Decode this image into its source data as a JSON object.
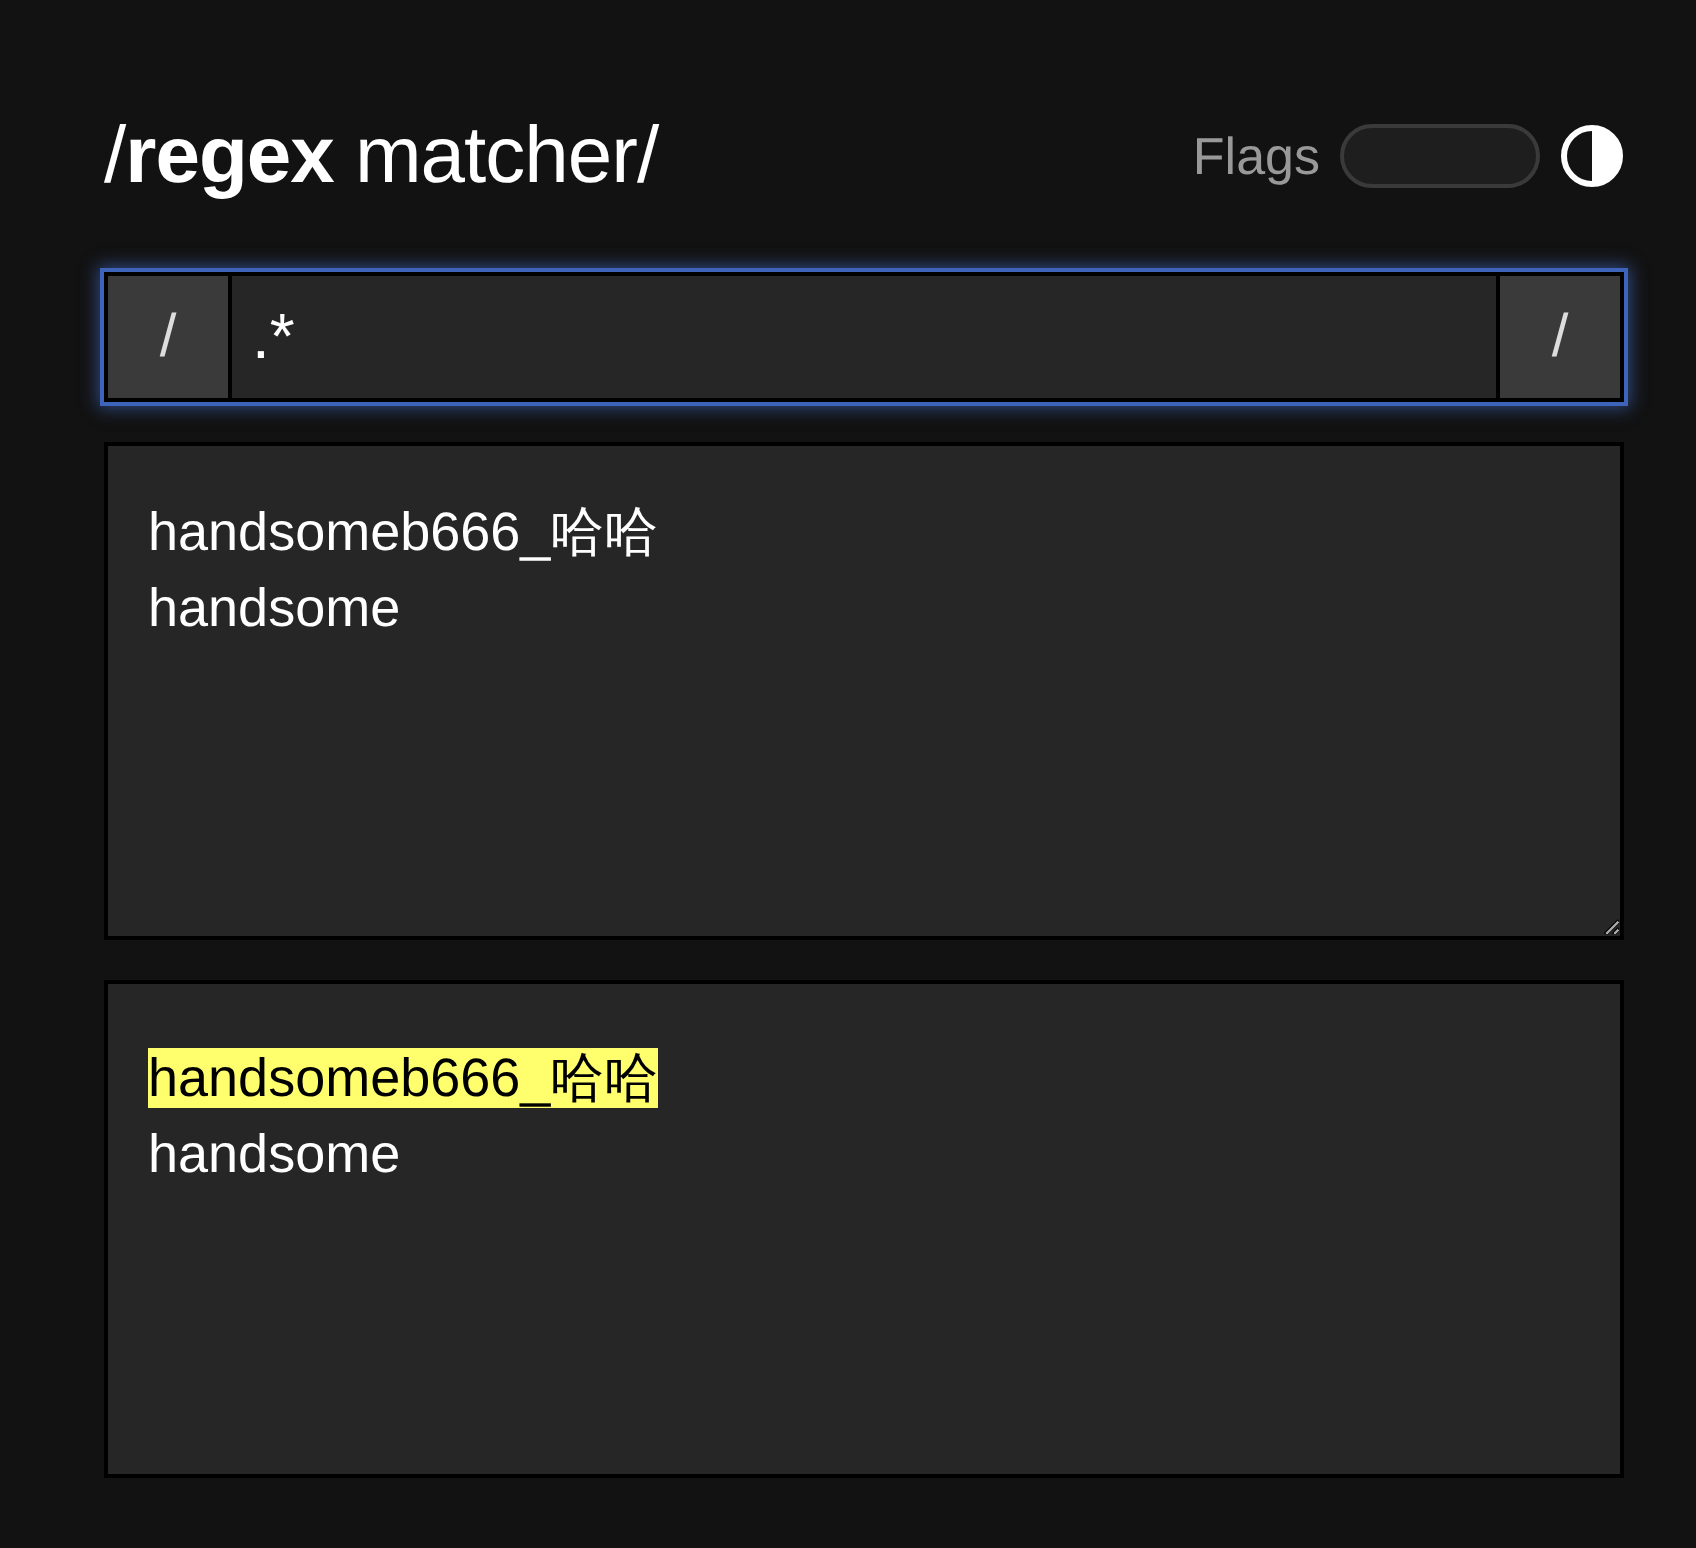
{
  "header": {
    "title": "/**regex** matcher/",
    "flags_label": "Flags"
  },
  "pattern": {
    "open_delimiter": "/",
    "value": ".*",
    "close_delimiter": "/",
    "focused": true
  },
  "test_text": "handsomeb666_哈哈\nhandsome",
  "results": [
    {
      "text": "handsomeb666_哈哈",
      "matched": true
    },
    {
      "text": "handsome",
      "matched": false
    }
  ]
}
